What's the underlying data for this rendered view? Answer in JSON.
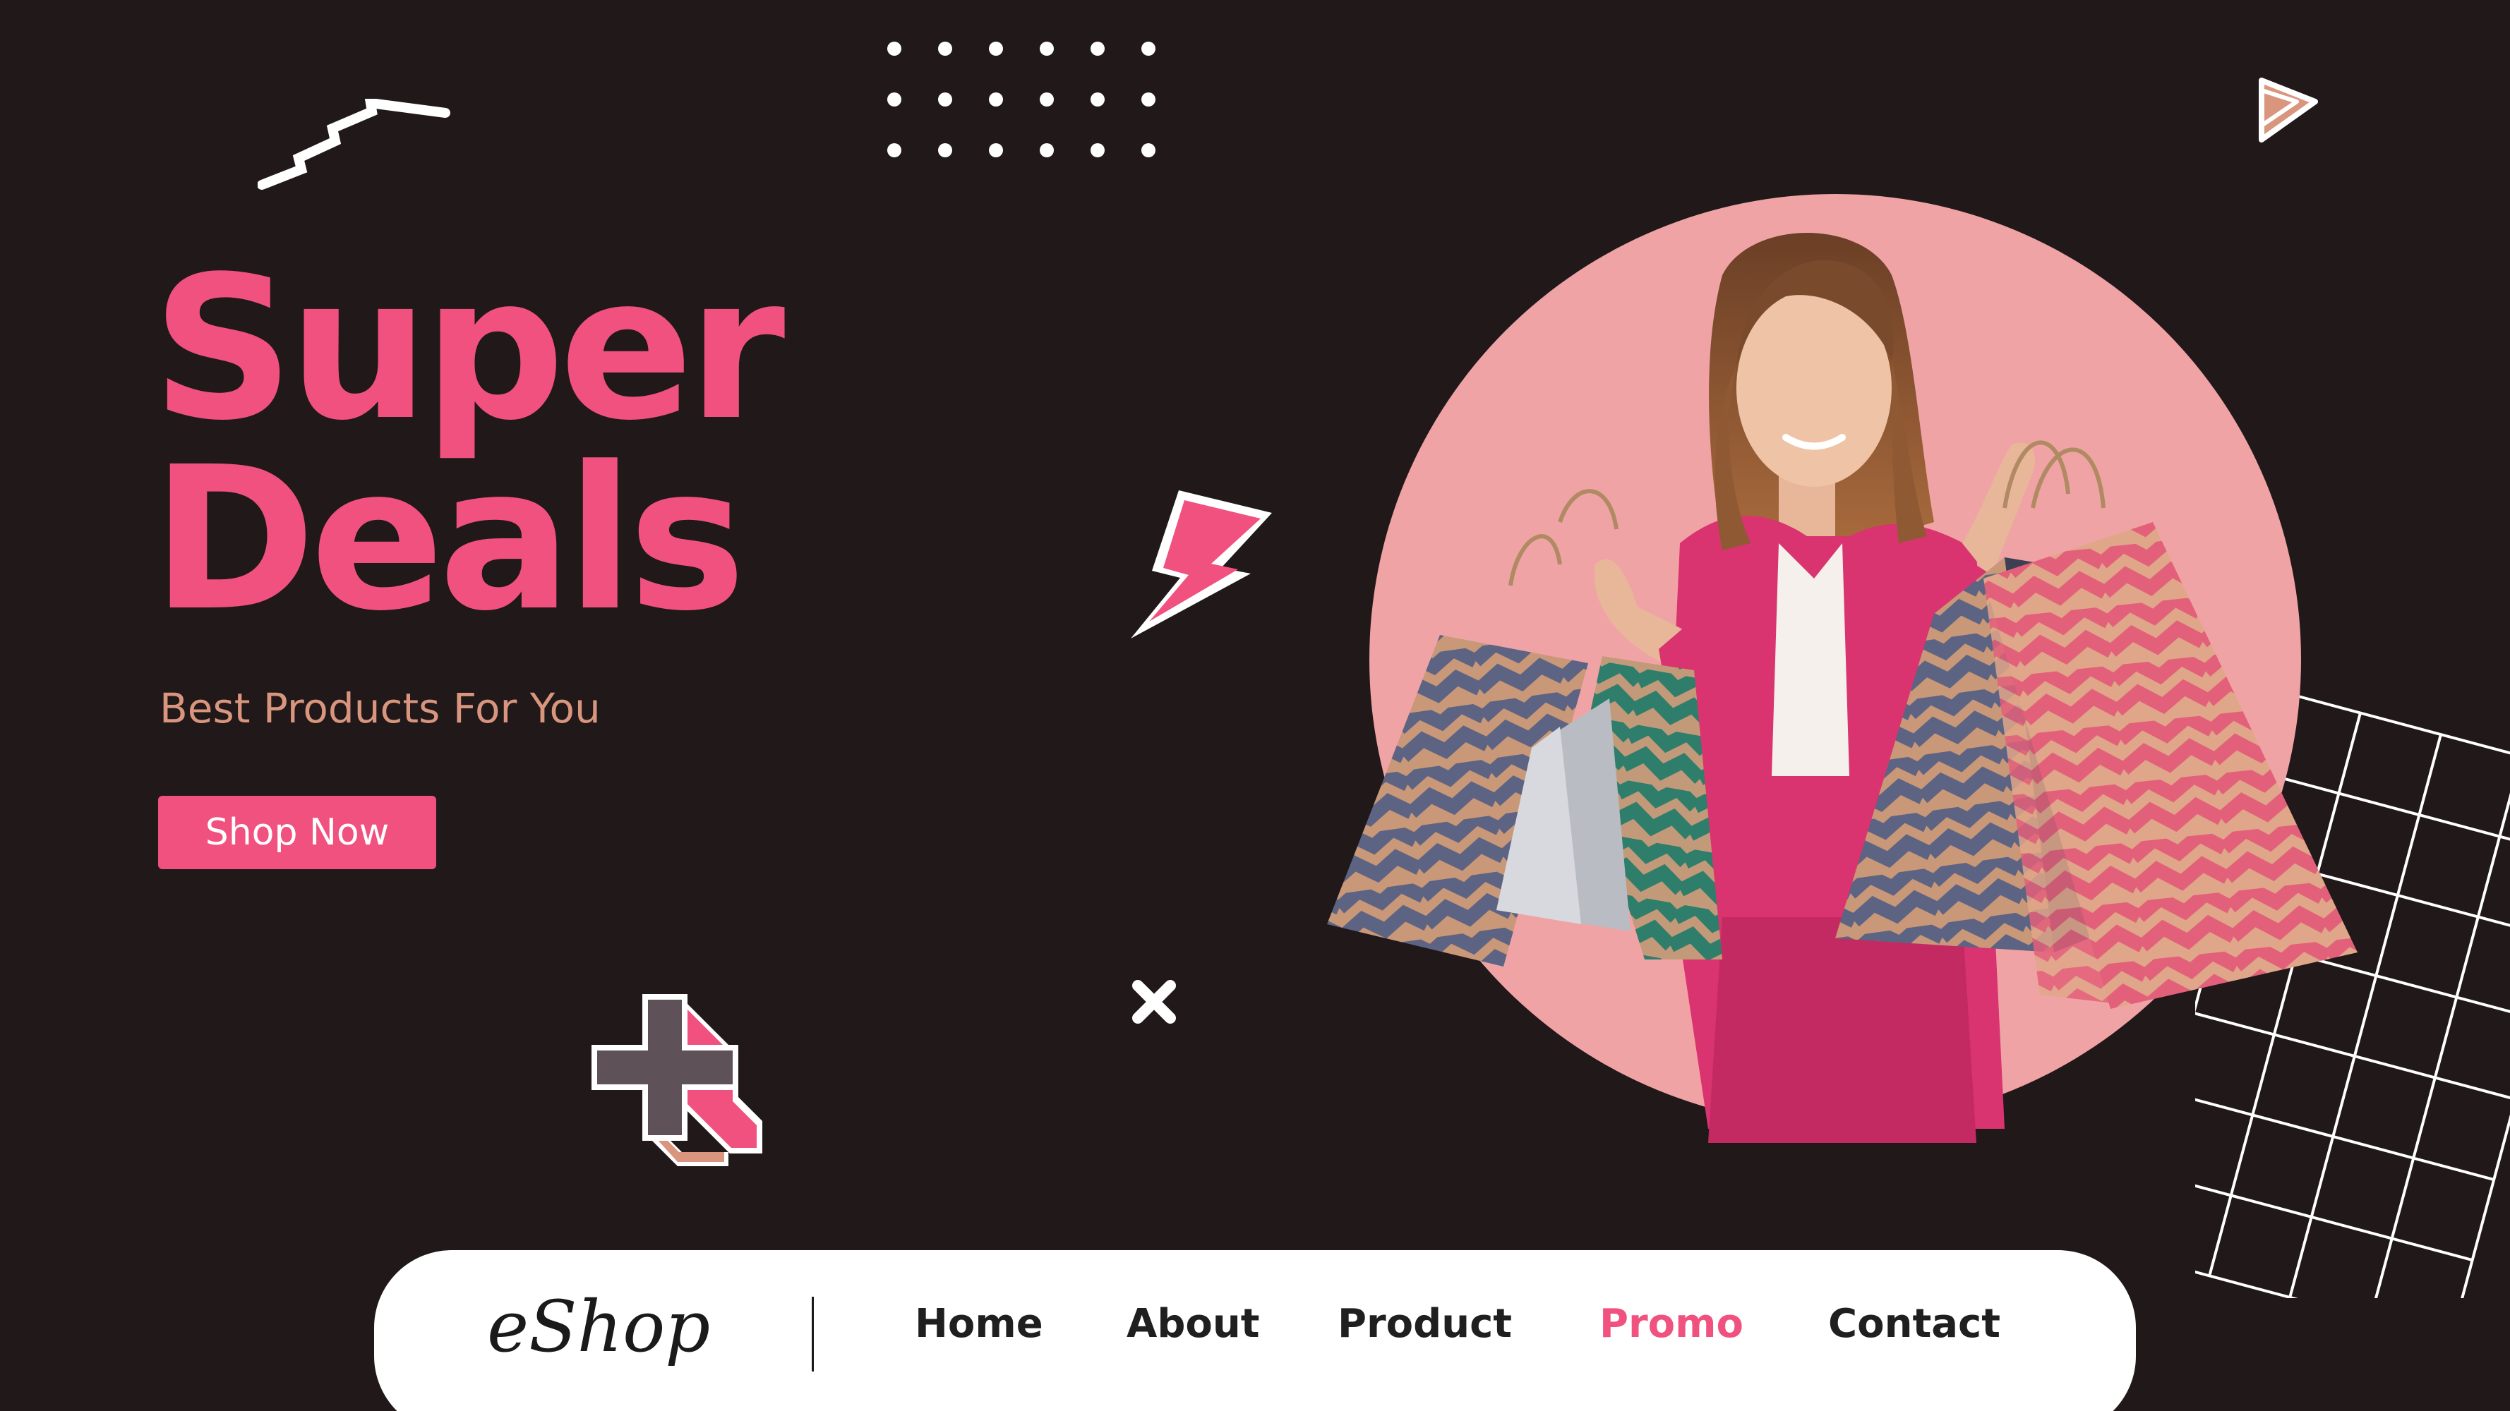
{
  "colors": {
    "background": "#201819",
    "accent": "#f0517f",
    "subtitle": "#d9957d",
    "circle": "#f0a3a5",
    "nav_bg": "#ffffff",
    "nav_text": "#1f1f1f"
  },
  "hero": {
    "title_line1": "Super",
    "title_line2": "Deals",
    "subtitle": "Best Products For You",
    "cta_label": "Shop Now"
  },
  "navbar": {
    "logo": "eShop",
    "items": [
      {
        "label": "Home",
        "active": false
      },
      {
        "label": "About",
        "active": false
      },
      {
        "label": "Product",
        "active": false
      },
      {
        "label": "Promo",
        "active": true
      },
      {
        "label": "Contact",
        "active": false
      }
    ]
  },
  "decorations": [
    "zigzag-icon",
    "dot-grid",
    "play-icon",
    "lightning-bolt-icon",
    "x-icon",
    "plus-icon",
    "grid-lines"
  ]
}
